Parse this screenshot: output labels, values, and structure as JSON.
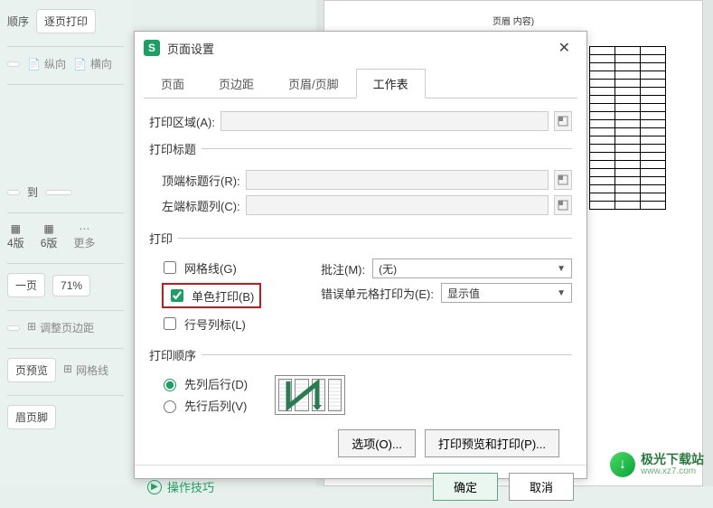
{
  "bg": {
    "orderLabel": "顺序",
    "pagePrint": "逐页打印",
    "portrait": "纵向",
    "landscape": "横向",
    "to": "到",
    "layout4": "4版",
    "layout6": "6版",
    "more": "更多",
    "onePage": "一页",
    "zoom": "71%",
    "adjustMargins": "调整页边距",
    "printPreview": "页预览",
    "gridlines": "网格线",
    "headerFooter": "眉页脚"
  },
  "preview": {
    "header": "页眉 内容)"
  },
  "dialog": {
    "title": "页面设置"
  },
  "tabs": [
    "页面",
    "页边距",
    "页眉/页脚",
    "工作表"
  ],
  "fields": {
    "printArea": "打印区域(A):",
    "printTitles": "打印标题",
    "topRow": "顶端标题行(R):",
    "leftCol": "左端标题列(C):"
  },
  "printSection": {
    "legend": "打印",
    "gridlines": "网格线(G)",
    "monochrome": "单色打印(B)",
    "rowColHeader": "行号列标(L)",
    "comments": "批注(M):",
    "errorCells": "错误单元格打印为(E):",
    "commentOption": "(无)",
    "errorOption": "显示值"
  },
  "orderSection": {
    "legend": "打印顺序",
    "downThenOver": "先列后行(D)",
    "overThenDown": "先行后列(V)"
  },
  "buttons": {
    "options": "选项(O)...",
    "previewPrint": "打印预览和打印(P)...",
    "tips": "操作技巧",
    "ok": "确定",
    "cancel": "取消"
  },
  "watermark": {
    "name": "极光下载站",
    "url": "www.xz7.com"
  }
}
